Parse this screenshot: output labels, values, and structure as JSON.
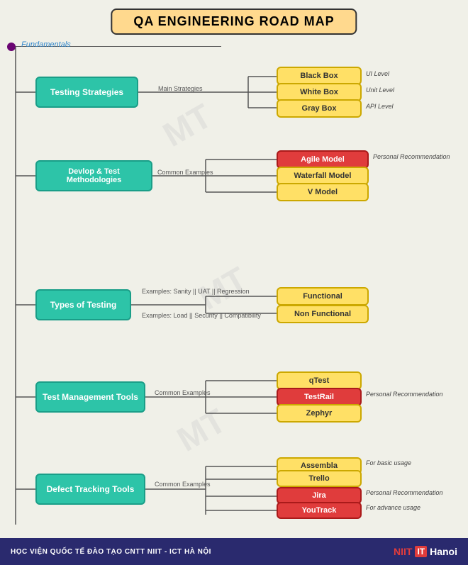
{
  "title": "QA ENGINEERING ROAD MAP",
  "fundamentals": "Fundamentals",
  "footer": {
    "text": "HỌC VIỆN QUỐC TẾ ĐÀO TẠO CNTT NIIT - ICT HÀ NỘI",
    "logo_niit": "NIIT",
    "logo_it": "IT",
    "logo_hanoi": "Hanoi"
  },
  "nodes": {
    "testing_strategies": "Testing Strategies",
    "devlop_methodologies": "Devlop & Test Methodologies",
    "types_of_testing": "Types of Testing",
    "test_management": "Test Management Tools",
    "defect_tracking": "Defect Tracking Tools"
  },
  "children": {
    "black_box": "Black Box",
    "white_box": "White Box",
    "gray_box": "Gray Box",
    "agile_model": "Agile Model",
    "waterfall_model": "Waterfall Model",
    "v_model": "V Model",
    "functional": "Functional",
    "non_functional": "Non Functional",
    "qtest": "qTest",
    "testrail": "TestRail",
    "zephyr": "Zephyr",
    "assembla": "Assembla",
    "trello": "Trello",
    "jira": "Jira",
    "youtrack": "YouTrack"
  },
  "labels": {
    "main_strategies": "Main Strategies",
    "common_examples": "Common Examples",
    "examples_sanity": "Examples: Sanity || UAT || Regression",
    "examples_load": "Examples: Load || Security || Compatibility",
    "ui_level": "UI Level",
    "unit_level": "Unit Level",
    "api_level": "API Level",
    "personal_recommendation_agile": "Personal Recommendation",
    "personal_recommendation_testrail": "Personal Recommendation",
    "for_basic_usage": "For basic usage",
    "for_advance_usage": "For advance usage",
    "personal_recommendation_jira": "Personal Recommendation"
  }
}
